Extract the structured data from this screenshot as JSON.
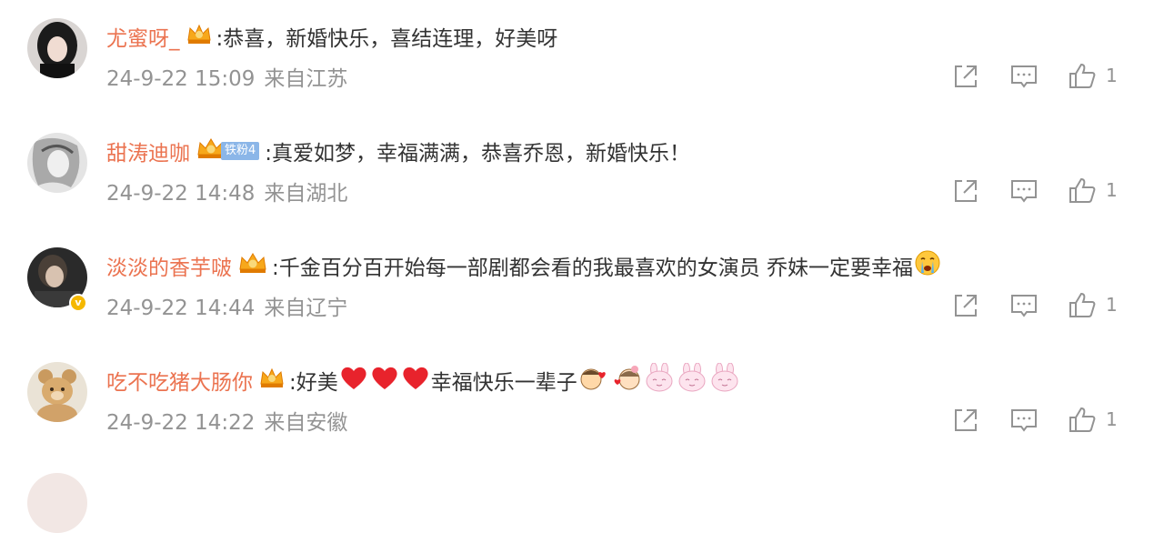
{
  "comments": [
    {
      "username": "尤蜜呀_",
      "fan_badge": "",
      "text": ":恭喜，新婚快乐，喜结连理，好美呀",
      "date": "24-9-22 15:09",
      "location": "来自江苏",
      "like_count": "1"
    },
    {
      "username": "甜涛迪咖",
      "fan_badge": "铁粉4",
      "text": ":真爱如梦，幸福满满，恭喜乔恩，新婚快乐！",
      "date": "24-9-22 14:48",
      "location": "来自湖北",
      "like_count": "1"
    },
    {
      "username": "淡淡的香芋啵",
      "fan_badge": "",
      "text": ":千金百分百开始每一部剧都会看的我最喜欢的女演员 乔妹一定要幸福",
      "date": "24-9-22 14:44",
      "location": "来自辽宁",
      "like_count": "1",
      "verified_badge": "v"
    },
    {
      "username": "吃不吃猪大肠你",
      "fan_badge": "",
      "text_before": ":好美",
      "text_after": "幸福快乐一辈子",
      "date": "24-9-22 14:22",
      "location": "来自安徽",
      "like_count": "1"
    }
  ],
  "colors": {
    "username": "#eb7350",
    "meta": "#939393",
    "text": "#333333",
    "fan_badge": "#8bb6e8"
  },
  "icons": [
    "share-icon",
    "comment-icon",
    "like-icon",
    "crown-icon",
    "heart-icon",
    "crying-emoji",
    "kiss-emoji",
    "bunny-emoji"
  ]
}
